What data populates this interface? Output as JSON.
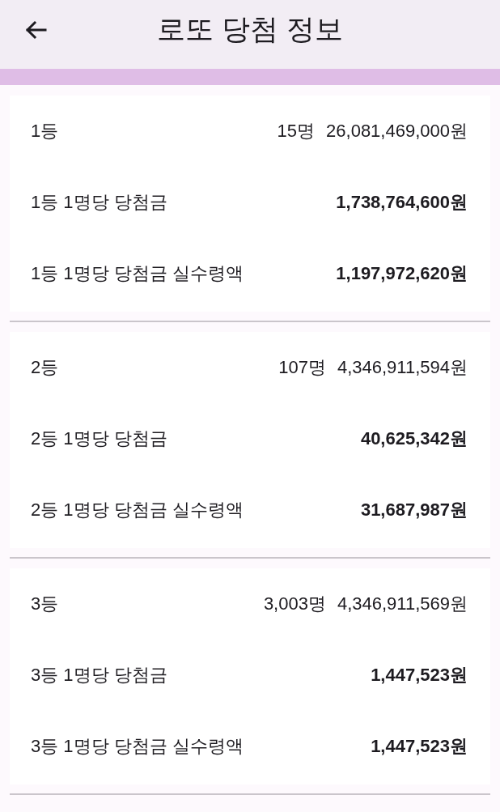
{
  "header": {
    "title": "로또 당첨 정보"
  },
  "prizes": [
    {
      "rows": [
        {
          "kind": "summary",
          "label": "1등",
          "count": "15명",
          "value": "26,081,469,000원"
        },
        {
          "kind": "amount",
          "label": "1등 1명당 당첨금",
          "value": "1,738,764,600원"
        },
        {
          "kind": "amount",
          "label": "1등 1명당 당첨금 실수령액",
          "value": "1,197,972,620원"
        }
      ]
    },
    {
      "rows": [
        {
          "kind": "summary",
          "label": "2등",
          "count": "107명",
          "value": "4,346,911,594원"
        },
        {
          "kind": "amount",
          "label": "2등 1명당 당첨금",
          "value": "40,625,342원"
        },
        {
          "kind": "amount",
          "label": "2등 1명당 당첨금 실수령액",
          "value": "31,687,987원"
        }
      ]
    },
    {
      "rows": [
        {
          "kind": "summary",
          "label": "3등",
          "count": "3,003명",
          "value": "4,346,911,569원"
        },
        {
          "kind": "amount",
          "label": "3등 1명당 당첨금",
          "value": "1,447,523원"
        },
        {
          "kind": "amount",
          "label": "3등 1명당 당첨금 실수령액",
          "value": "1,447,523원"
        }
      ]
    }
  ]
}
